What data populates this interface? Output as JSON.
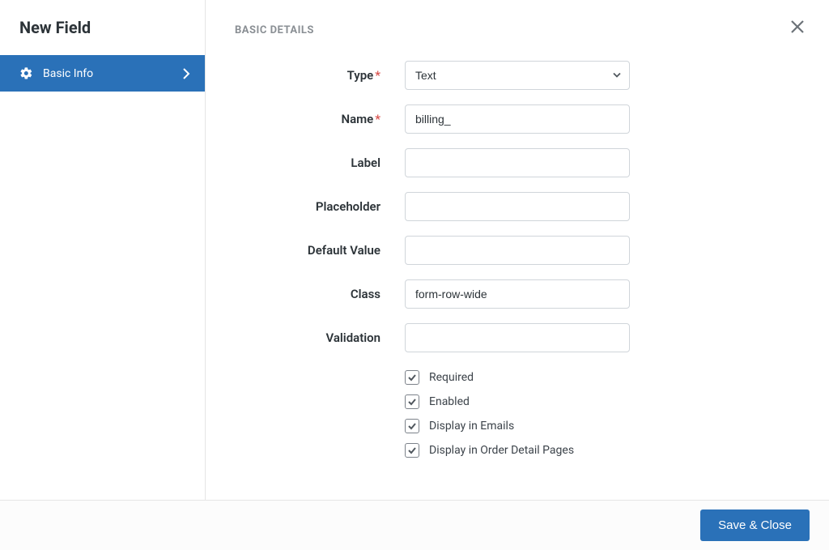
{
  "sidebar": {
    "title": "New Field",
    "item_label": "Basic Info"
  },
  "section_heading": "BASIC DETAILS",
  "form": {
    "type": {
      "label": "Type",
      "required": true,
      "value": "Text"
    },
    "name": {
      "label": "Name",
      "required": true,
      "value": "billing_"
    },
    "label_field": {
      "label": "Label",
      "value": ""
    },
    "placeholder_field": {
      "label": "Placeholder",
      "value": ""
    },
    "default_value": {
      "label": "Default Value",
      "value": ""
    },
    "class_field": {
      "label": "Class",
      "value": "form-row-wide"
    },
    "validation": {
      "label": "Validation",
      "value": ""
    }
  },
  "checkboxes": {
    "required": {
      "label": "Required",
      "checked": true
    },
    "enabled": {
      "label": "Enabled",
      "checked": true
    },
    "display_emails": {
      "label": "Display in Emails",
      "checked": true
    },
    "display_order": {
      "label": "Display in Order Detail Pages",
      "checked": true
    }
  },
  "footer": {
    "save": "Save & Close"
  }
}
